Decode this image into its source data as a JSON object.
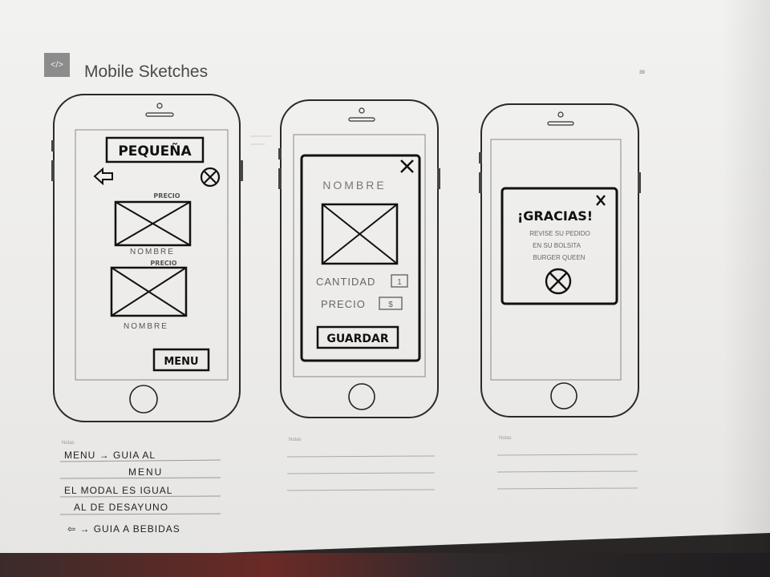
{
  "header": {
    "logo_icon": "code-brackets-icon",
    "logo_glyph": "</>",
    "title": "Mobile Sketches",
    "page_number": "39"
  },
  "screen1": {
    "title": "PEQUEÑA",
    "back_icon": "back-arrow-icon",
    "close_icon": "circle-x-icon",
    "items": [
      {
        "price_label": "PRECIO",
        "name_label": "NOMBRE",
        "image_icon": "image-placeholder-icon"
      },
      {
        "price_label": "PRECIO",
        "name_label": "NOMBRE",
        "image_icon": "image-placeholder-icon"
      }
    ],
    "menu_button": "MENU"
  },
  "screen2": {
    "close_icon": "close-x-icon",
    "name_label": "NOMBRE",
    "image_icon": "image-placeholder-icon",
    "quantity_label": "CANTIDAD",
    "quantity_value": "1",
    "price_label": "PRECIO",
    "price_value": "$",
    "save_button": "GUARDAR"
  },
  "screen3": {
    "close_icon": "close-x-icon",
    "thanks_title": "¡GRACIAS!",
    "message_lines": [
      "REVISE SU PEDIDO",
      "EN SU BOLSITA",
      "BURGER QUEEN"
    ],
    "confirm_icon": "circle-x-icon"
  },
  "notes": {
    "label": "Notas",
    "col1_lines": [
      "MENU → GUIA AL",
      "MENU",
      "EL MODAL ES IGUAL",
      "AL DE DESAYUNO",
      "⇦ → GUIA A BEBIDAS"
    ],
    "col2_label": "Notas",
    "col3_label": "Notas"
  }
}
